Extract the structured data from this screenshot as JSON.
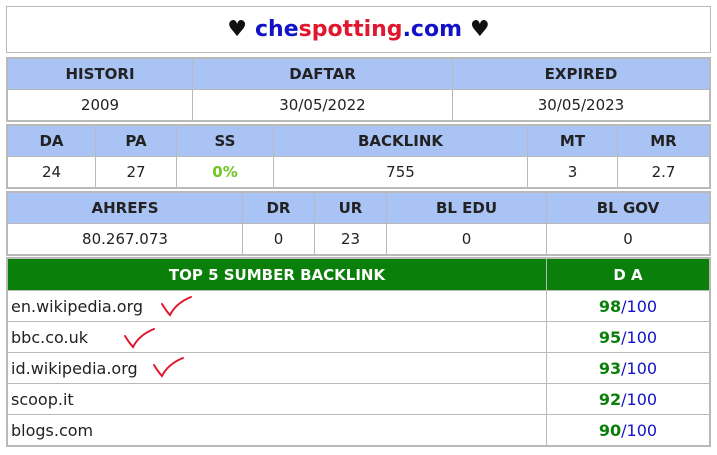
{
  "header": {
    "heart_left": "♥",
    "domain_part1": "che",
    "domain_part2": "spotting",
    "domain_part3": ".com",
    "heart_right": "♥"
  },
  "table1": {
    "headers": [
      "HISTORI",
      "DAFTAR",
      "EXPIRED"
    ],
    "values": [
      "2009",
      "30/05/2022",
      "30/05/2023"
    ]
  },
  "table2": {
    "headers": [
      "DA",
      "PA",
      "SS",
      "BACKLINK",
      "MT",
      "MR"
    ],
    "values": [
      "24",
      "27",
      "0%",
      "755",
      "3",
      "2.7"
    ]
  },
  "table3": {
    "headers": [
      "AHREFS",
      "DR",
      "UR",
      "BL EDU",
      "BL GOV"
    ],
    "values": [
      "80.267.073",
      "0",
      "23",
      "0",
      "0"
    ]
  },
  "backlinks": {
    "header_site": "TOP 5 SUMBER BACKLINK",
    "header_da": "D A",
    "rows": [
      {
        "site": "en.wikipedia.org",
        "score": "98",
        "sep": "/",
        "max": "100"
      },
      {
        "site": "bbc.co.uk",
        "score": "95",
        "sep": "/",
        "max": "100"
      },
      {
        "site": "id.wikipedia.org",
        "score": "93",
        "sep": "/",
        "max": "100"
      },
      {
        "site": "scoop.it",
        "score": "92",
        "sep": "/",
        "max": "100"
      },
      {
        "site": "blogs.com",
        "score": "90",
        "sep": "/",
        "max": "100"
      }
    ]
  },
  "colors": {
    "header_blue": "#a9c3f5",
    "header_green": "#0a7f0a",
    "accent_blue": "#1212c8",
    "accent_red": "#e0172e",
    "score_green": "#0a7f0a",
    "ss_green": "#6fc521",
    "check_red": "#e0172e"
  }
}
